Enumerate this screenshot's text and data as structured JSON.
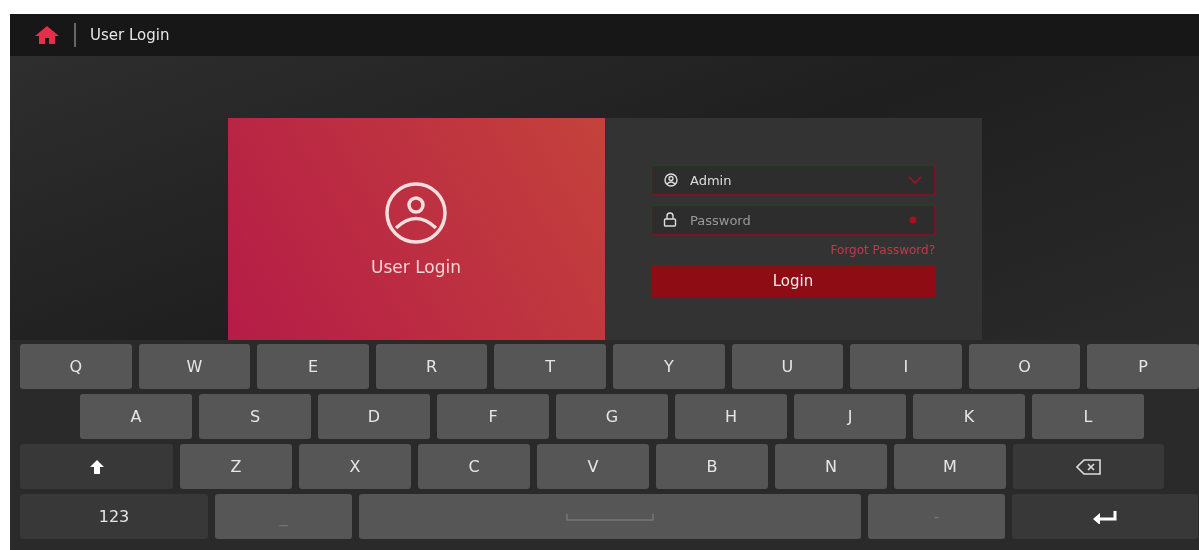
{
  "header": {
    "title": "User Login"
  },
  "login_panel": {
    "title": "User Login"
  },
  "form": {
    "user_field": {
      "value": "Admin"
    },
    "password_field": {
      "placeholder": "Password"
    },
    "forgot_link": "Forgot Password?",
    "login_button": "Login"
  },
  "keyboard": {
    "rows": [
      [
        {
          "kind": "letter",
          "label": "Q"
        },
        {
          "kind": "letter",
          "label": "W"
        },
        {
          "kind": "letter",
          "label": "E"
        },
        {
          "kind": "letter",
          "label": "R"
        },
        {
          "kind": "letter",
          "label": "T"
        },
        {
          "kind": "letter",
          "label": "Y"
        },
        {
          "kind": "letter",
          "label": "U"
        },
        {
          "kind": "letter",
          "label": "I"
        },
        {
          "kind": "letter",
          "label": "O"
        },
        {
          "kind": "letter",
          "label": "P"
        }
      ],
      [
        {
          "kind": "letter",
          "label": "A"
        },
        {
          "kind": "letter",
          "label": "S"
        },
        {
          "kind": "letter",
          "label": "D"
        },
        {
          "kind": "letter",
          "label": "F"
        },
        {
          "kind": "letter",
          "label": "G"
        },
        {
          "kind": "letter",
          "label": "H"
        },
        {
          "kind": "letter",
          "label": "J"
        },
        {
          "kind": "letter",
          "label": "K"
        },
        {
          "kind": "letter",
          "label": "L"
        }
      ],
      [
        {
          "kind": "shift"
        },
        {
          "kind": "letter",
          "label": "Z"
        },
        {
          "kind": "letter",
          "label": "X"
        },
        {
          "kind": "letter",
          "label": "C"
        },
        {
          "kind": "letter",
          "label": "V"
        },
        {
          "kind": "letter",
          "label": "B"
        },
        {
          "kind": "letter",
          "label": "N"
        },
        {
          "kind": "letter",
          "label": "M"
        },
        {
          "kind": "backspace"
        }
      ],
      [
        {
          "kind": "mode",
          "label": "123"
        },
        {
          "kind": "symbol",
          "label": "_"
        },
        {
          "kind": "space"
        },
        {
          "kind": "symbol",
          "label": "-"
        },
        {
          "kind": "enter"
        }
      ]
    ]
  }
}
